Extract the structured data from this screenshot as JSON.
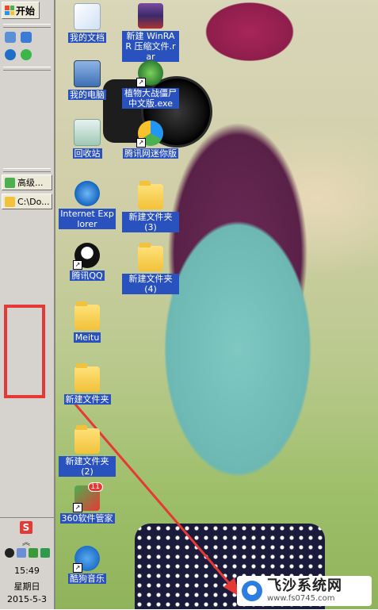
{
  "taskbar": {
    "start_label": "开始",
    "tasks": [
      {
        "label": "高级..."
      },
      {
        "label": "C:\\Do..."
      }
    ],
    "tray": {
      "s_label": "S",
      "time": "15:49",
      "weekday": "星期日",
      "date": "2015-5-3"
    }
  },
  "desktop": {
    "icons": [
      {
        "label": "我的文档"
      },
      {
        "label": "新建 WinRAR 压缩文件.rar"
      },
      {
        "label": "我的电脑"
      },
      {
        "label": "植物大战僵尸中文版.exe"
      },
      {
        "label": "回收站"
      },
      {
        "label": "腾讯网迷你版"
      },
      {
        "label": "Internet Explorer"
      },
      {
        "label": "新建文件夹 (3)"
      },
      {
        "label": "腾讯QQ"
      },
      {
        "label": "新建文件夹 (4)"
      },
      {
        "label": "Meitu"
      },
      {
        "label": "新建文件夹"
      },
      {
        "label": "新建文件夹 (2)"
      },
      {
        "label": "360软件管家",
        "badge": "11"
      },
      {
        "label": "酷狗音乐"
      }
    ]
  },
  "watermark": {
    "title": "飞沙系统网",
    "url": "www.fs0745.com"
  },
  "colors": {
    "selection": "#2a52be",
    "taskbar": "#d6d3ce",
    "highlight_box": "#e53935"
  }
}
